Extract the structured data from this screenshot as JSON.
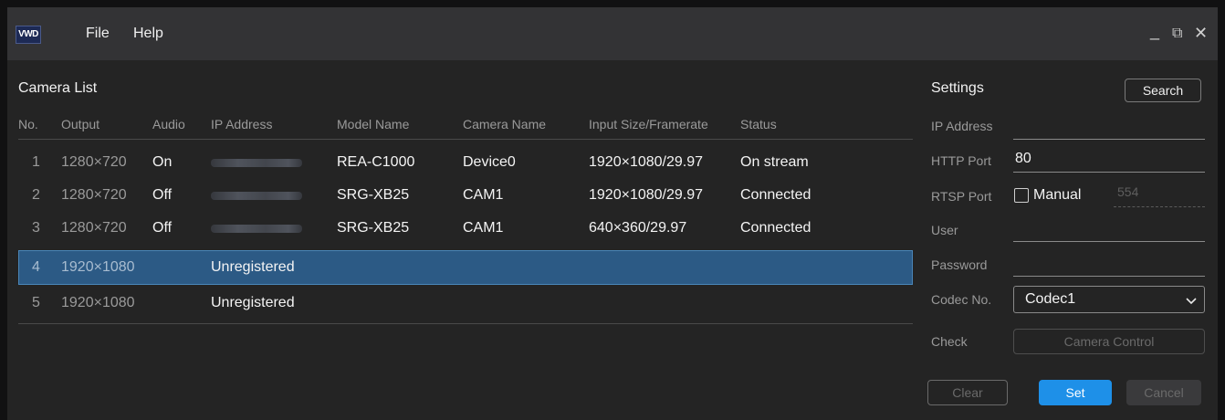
{
  "titlebar": {
    "logo": "VWD",
    "menu": [
      "File",
      "Help"
    ],
    "controls": {
      "minimize": "_",
      "restore": "⧉",
      "close": "✕"
    }
  },
  "camera_list": {
    "title": "Camera List",
    "columns": [
      "No.",
      "Output",
      "Audio",
      "IP Address",
      "Model Name",
      "Camera Name",
      "Input Size/Framerate",
      "Status"
    ],
    "rows": [
      {
        "no": "1",
        "output": "1280×720",
        "audio": "On",
        "ip": "",
        "model": "REA-C1000",
        "camera": "Device0",
        "input": "1920×1080/29.97",
        "status": "On stream",
        "selected": false
      },
      {
        "no": "2",
        "output": "1280×720",
        "audio": "Off",
        "ip": "",
        "model": "SRG-XB25",
        "camera": "CAM1",
        "input": "1920×1080/29.97",
        "status": "Connected",
        "selected": false
      },
      {
        "no": "3",
        "output": "1280×720",
        "audio": "Off",
        "ip": "",
        "model": "SRG-XB25",
        "camera": "CAM1",
        "input": "640×360/29.97",
        "status": "Connected",
        "selected": false
      },
      {
        "no": "4",
        "output": "1920×1080",
        "audio": "",
        "ip": "Unregistered",
        "model": "",
        "camera": "",
        "input": "",
        "status": "",
        "selected": true
      },
      {
        "no": "5",
        "output": "1920×1080",
        "audio": "",
        "ip": "Unregistered",
        "model": "",
        "camera": "",
        "input": "",
        "status": "",
        "selected": false
      }
    ]
  },
  "settings": {
    "title": "Settings",
    "search_label": "Search",
    "ip_address": {
      "label": "IP Address",
      "value": ""
    },
    "http_port": {
      "label": "HTTP Port",
      "value": "80"
    },
    "rtsp_port": {
      "label": "RTSP Port",
      "manual_label": "Manual",
      "manual_checked": false,
      "value": "554"
    },
    "user": {
      "label": "User",
      "value": ""
    },
    "password": {
      "label": "Password",
      "value": ""
    },
    "codec": {
      "label": "Codec No.",
      "value": "Codec1"
    },
    "check": {
      "label": "Check",
      "button": "Camera Control"
    },
    "buttons": {
      "clear": "Clear",
      "set": "Set",
      "cancel": "Cancel"
    }
  },
  "colors": {
    "accent": "#1e90e8",
    "selection": "#2c5a85"
  }
}
